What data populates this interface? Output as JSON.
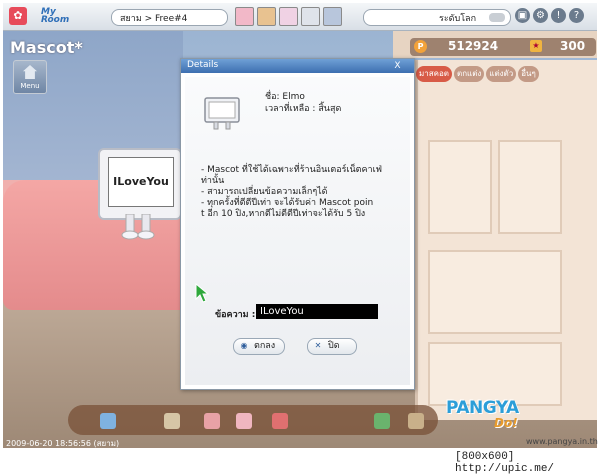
{
  "topbar": {
    "myroom_label": "My\nRoom",
    "location": "สยาม > Free#4",
    "world": "ระดับโลก"
  },
  "scene": {
    "room_title": "Mascot*",
    "menu_label": "Menu",
    "pang_amount": "512924",
    "cookie_amount": "300",
    "tabs": [
      "มาสคอต",
      "ตกแต่ง",
      "แต่งตัว",
      "อื่นๆ"
    ],
    "mascot_screen_text": "ILoveYou"
  },
  "dialog": {
    "title": "Details",
    "close": "X",
    "name_line": "ชื่อ: Elmo",
    "time_line": "เวลาที่เหลือ : สิ้นสุด",
    "description": [
      "- Mascot ที่ใช้ได้เฉพาะที่ร้านอินเตอร์เน็ตคาเฟ่",
      "ท่านั้น",
      "- สามารถเปลี่ยนข้อความเล็กๆได้",
      "- ทุกครั้งที่ตีตีปีเท่า จะได้รับค่า Mascot poin",
      "t อีก 10 ปิง,หากตีไม่ตีตีปีเท่าจะได้รับ 5 ปิง"
    ],
    "message_label": "ข้อความ :",
    "message_value": "ILoveYou",
    "ok_label": "ตกลง",
    "cancel_label": "ปิด"
  },
  "footer": {
    "timestamp": "2009-06-20 18:56:56 (สยาม)",
    "site": "www.pangya.in.th",
    "logo": "PANGYA",
    "logo_sub": "Do!",
    "resolution_note": "[800x600] http://upic.me/"
  },
  "colors": {
    "title_bar": "#3d6fb0",
    "accent_tab": "#d85b47",
    "pang": "#f2a23a"
  }
}
